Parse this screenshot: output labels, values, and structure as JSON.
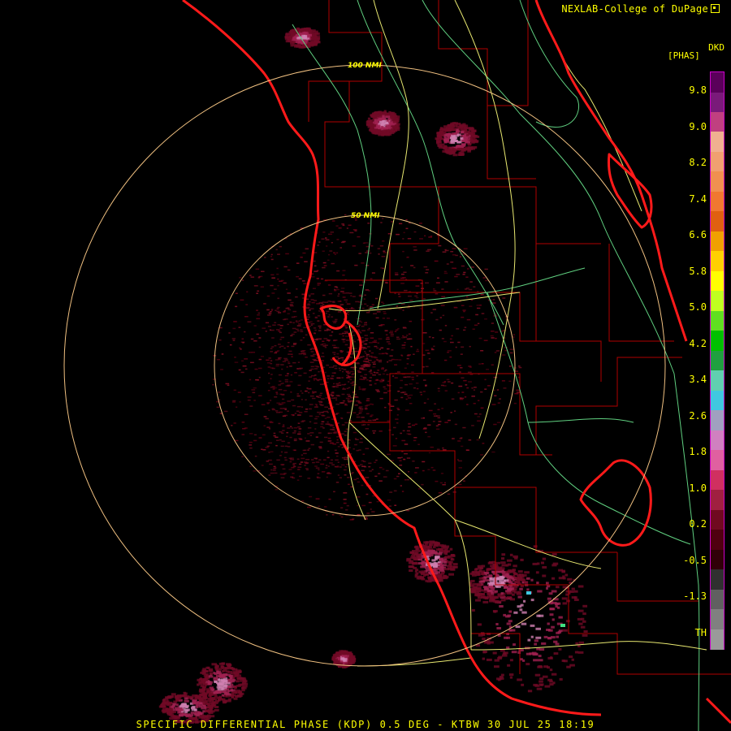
{
  "credit": "NEXLAB-College of DuPage",
  "legend": {
    "product": "DKD",
    "unit": "[PHAS]",
    "ticks": [
      "9.8",
      "9.0",
      "8.2",
      "7.4",
      "6.6",
      "5.8",
      "5.0",
      "4.2",
      "3.4",
      "2.6",
      "1.8",
      "1.0",
      "0.2",
      "-0.5",
      "-1.3",
      "TH"
    ],
    "colors": [
      "#5a005a",
      "#7a1a7a",
      "#c04080",
      "#f0b090",
      "#f0a070",
      "#f09050",
      "#f07830",
      "#e06010",
      "#f0a000",
      "#ffd000",
      "#ffff00",
      "#c0ff20",
      "#60e020",
      "#00c000",
      "#20a040",
      "#60d0b0",
      "#40c8e0",
      "#a0a0c0",
      "#d080c0",
      "#e060a0",
      "#d03060",
      "#a02040",
      "#700a20",
      "#500010",
      "#300008",
      "#303030",
      "#606060",
      "#808080",
      "#9a9a9a"
    ]
  },
  "rings": [
    {
      "label": "100 NMI",
      "range_nmi": 100
    },
    {
      "label": "50 NMI",
      "range_nmi": 50
    }
  ],
  "caption": "SPECIFIC DIFFERENTIAL PHASE (KDP) 0.5 DEG - KTBW 30 JUL 25 18:19",
  "colors": {
    "coast": "#ff1a1a",
    "county": "#b00000",
    "roads": "#e8e870",
    "highway": "#60d080",
    "ring": "#f0c080",
    "text": "#ffff00"
  }
}
